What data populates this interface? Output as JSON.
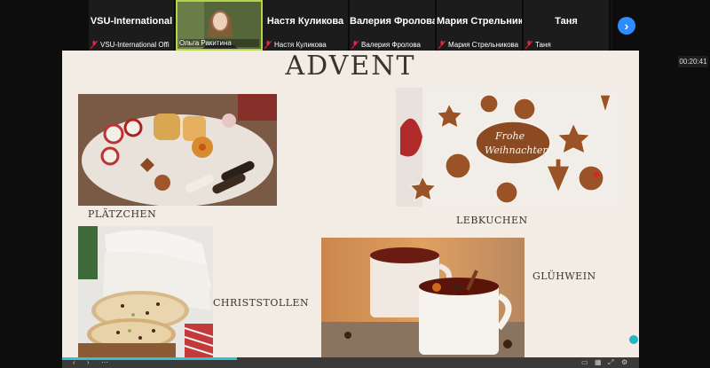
{
  "participants": [
    {
      "name": "VSU-International",
      "label": "VSU-International Offi",
      "video": false
    },
    {
      "name": "",
      "label": "Ольга Ракитина",
      "video": true
    },
    {
      "name": "Настя Куликова",
      "label": "Настя Куликова",
      "video": false
    },
    {
      "name": "Валерия Фролова",
      "label": "Валерия Фролова",
      "video": false
    },
    {
      "name": "Мария Стрельникова",
      "label": "Мария Стрельникова",
      "video": false
    },
    {
      "name": "Таня",
      "label": "Таня",
      "video": false
    }
  ],
  "timer": "00:20:41",
  "slide": {
    "title": "ADVENT",
    "labels": {
      "platzchen": "PLÄTZCHEN",
      "lebkuchen": "LEBKUCHEN",
      "christstollen": "CHRISTSTOLLEN",
      "gluhwein": "GLÜHWEIN"
    },
    "lebkuchen_text": [
      "Frohe",
      "Weihnachten"
    ]
  },
  "colors": {
    "accent": "#2d8cff",
    "slide_bg": "#f3ece5",
    "progress": "#2ec4d6"
  }
}
